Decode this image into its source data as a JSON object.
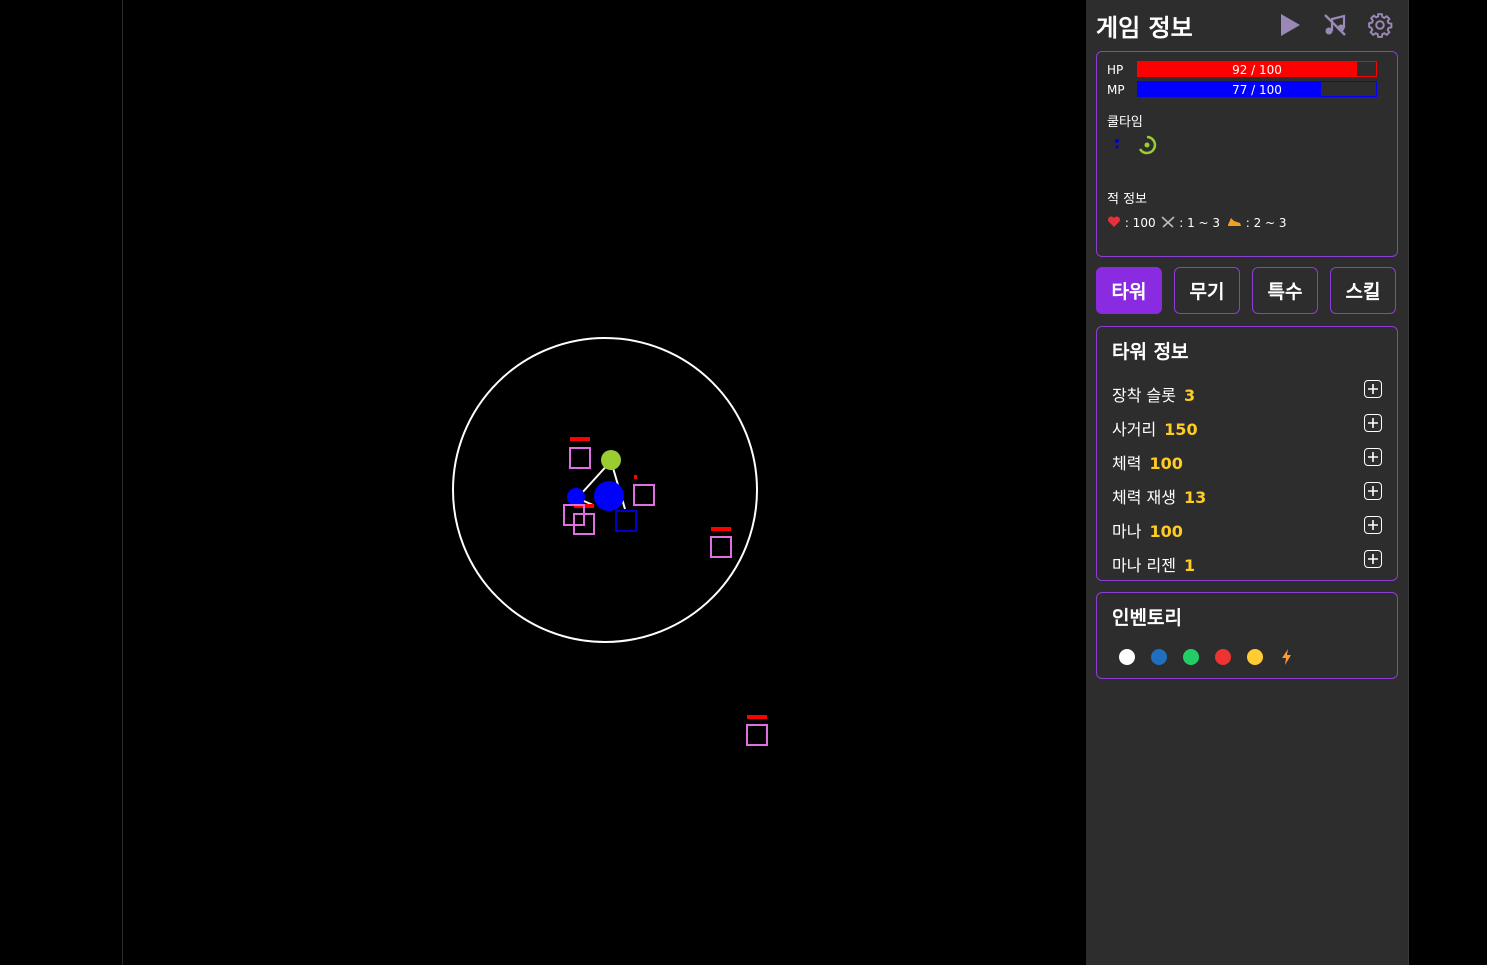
{
  "panel": {
    "title": "게임 정보",
    "header_icons": [
      "play-icon",
      "music-off-icon",
      "gear-icon"
    ]
  },
  "stats": {
    "hp": {
      "label": "HP",
      "value": 92,
      "max": 100,
      "text": "92 / 100",
      "color": "#ff0000"
    },
    "mp": {
      "label": "MP",
      "value": 77,
      "max": 100,
      "text": "77 / 100",
      "color": "#0000ff"
    }
  },
  "cooldown": {
    "label": "쿨타임"
  },
  "enemy": {
    "label": "적 정보",
    "hp_icon": "heart-icon",
    "hp_text": ": 100",
    "atk_icon": "crossed-swords-icon",
    "atk_text": ": 1 ~ 3",
    "speed_icon": "running-shoe-icon",
    "speed_text": ": 2 ~ 3"
  },
  "tabs": [
    {
      "label": "타워",
      "active": true
    },
    {
      "label": "무기",
      "active": false
    },
    {
      "label": "특수",
      "active": false
    },
    {
      "label": "스킬",
      "active": false
    }
  ],
  "tower_info": {
    "title": "타워 정보",
    "rows": [
      {
        "label": "장착 슬롯",
        "value": "3"
      },
      {
        "label": "사거리",
        "value": "150"
      },
      {
        "label": "체력",
        "value": "100"
      },
      {
        "label": "체력 재생",
        "value": "13"
      },
      {
        "label": "마나",
        "value": "100"
      },
      {
        "label": "마나 리젠",
        "value": "1"
      }
    ]
  },
  "inventory": {
    "title": "인벤토리",
    "items": [
      {
        "name": "white-orb",
        "color": "#ffffff"
      },
      {
        "name": "blue-orb",
        "color": "#1f6fbf"
      },
      {
        "name": "green-orb",
        "color": "#22cc66"
      },
      {
        "name": "red-orb",
        "color": "#ee3333"
      },
      {
        "name": "yellow-orb",
        "color": "#ffcc33"
      },
      {
        "name": "lightning-icon",
        "color": "#ff9933"
      }
    ]
  },
  "colors": {
    "accent": "#8a2be2",
    "border": "#8a3fd0",
    "value": "#ffcc22",
    "enemy": "#e070e0",
    "enemy_hp": "#ff0000"
  }
}
